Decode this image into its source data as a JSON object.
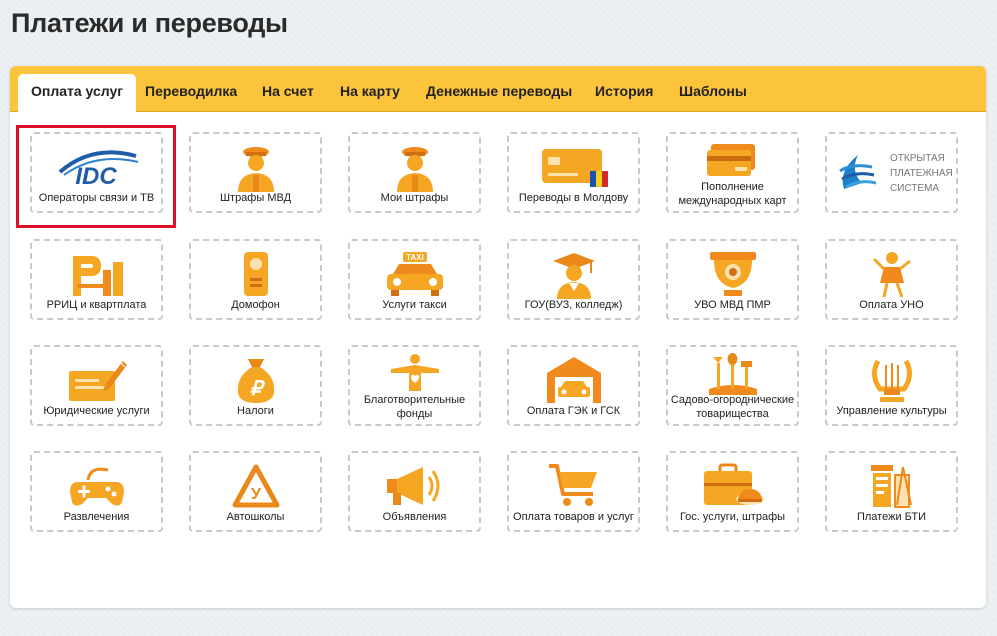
{
  "page": {
    "title": "Платежи и переводы"
  },
  "tabs": [
    {
      "label": "Оплата услуг",
      "active": true
    },
    {
      "label": "Переводилка"
    },
    {
      "label": "На счет"
    },
    {
      "label": "На карту"
    },
    {
      "label": "Денежные переводы"
    },
    {
      "label": "История"
    },
    {
      "label": "Шаблоны"
    }
  ],
  "tiles": [
    {
      "label": "Операторы связи и ТВ",
      "icon": "idc-logo"
    },
    {
      "label": "Штрафы МВД",
      "icon": "police-officer-icon"
    },
    {
      "label": "Мои штрафы",
      "icon": "police-officer-icon"
    },
    {
      "label": "Переводы в Молдову",
      "icon": "bank-card-moldova-flag-icon"
    },
    {
      "label": "Пополнение международных карт",
      "icon": "card-stack-icon"
    },
    {
      "label": "",
      "icon": "open-payment-system-logo"
    },
    {
      "label": "РРИЦ и квартплата",
      "icon": "rric-building-icon"
    },
    {
      "label": "Домофон",
      "icon": "intercom-icon"
    },
    {
      "label": "Услуги такси",
      "icon": "taxi-icon"
    },
    {
      "label": "ГОУ(ВУЗ, колледж)",
      "icon": "graduate-icon"
    },
    {
      "label": "УВО МВД ПМР",
      "icon": "security-camera-icon"
    },
    {
      "label": "Оплата УНО",
      "icon": "playing-child-icon"
    },
    {
      "label": "Юридические услуги",
      "icon": "document-pen-icon"
    },
    {
      "label": "Налоги",
      "icon": "money-bag-icon"
    },
    {
      "label": "Благотворительные фонды",
      "icon": "charity-person-icon"
    },
    {
      "label": "Оплата ГЭК и ГСК",
      "icon": "garage-car-icon"
    },
    {
      "label": "Садово-огороднические товарищества",
      "icon": "garden-tools-icon"
    },
    {
      "label": "Управление культуры",
      "icon": "lyre-icon"
    },
    {
      "label": "Развлечения",
      "icon": "gamepad-icon"
    },
    {
      "label": "Автошколы",
      "icon": "driving-school-sign-icon"
    },
    {
      "label": "Объявления",
      "icon": "megaphone-icon"
    },
    {
      "label": "Оплата товаров и услуг",
      "icon": "shopping-cart-icon"
    },
    {
      "label": "Гос. услуги, штрафы",
      "icon": "briefcase-cap-icon"
    },
    {
      "label": "Платежи БТИ",
      "icon": "drafting-tools-icon"
    }
  ],
  "logos": {
    "idc": "IDC",
    "ops": [
      "ОТКРЫТАЯ",
      "ПЛАТЕЖНАЯ",
      "СИСТЕМА"
    ],
    "taxi": "TAXI",
    "tax": "₽",
    "driving": "У"
  },
  "colors": {
    "accent": "#f5a623",
    "accent_dark": "#e8891a",
    "tab_bar": "#fcc43a",
    "highlight": "#e0102a",
    "idc_blue": "#1f5da8"
  }
}
